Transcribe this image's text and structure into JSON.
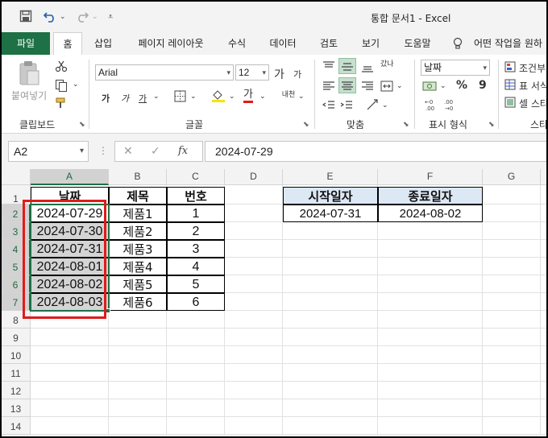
{
  "titlebar": {
    "title": "통합 문서1  -  Excel",
    "save_icon": "save-icon",
    "undo_icon": "undo-icon",
    "redo_icon": "redo-icon"
  },
  "tabs": [
    "파일",
    "홈",
    "삽입",
    "페이지 레이아웃",
    "수식",
    "데이터",
    "검토",
    "보기",
    "도움말"
  ],
  "tell_me": "어떤 작업을 원하",
  "ribbon": {
    "clipboard": {
      "paste": "붙여넣기",
      "label": "클립보드"
    },
    "font": {
      "name": "Arial",
      "size": "12",
      "grow": "가",
      "shrink": "가",
      "bold": "가",
      "italic": "가",
      "underline": "가",
      "color_a": "가",
      "phonetic": "내천",
      "label": "글꼴"
    },
    "align": {
      "wrap": "갔나",
      "label": "맞춤"
    },
    "number": {
      "format": "날짜",
      "percent": "%",
      "comma": "9",
      "label": "표시 형식"
    },
    "styles": {
      "cond": "조건부",
      "table": "표 서식",
      "cell": "셀 스타",
      "label": "스타"
    }
  },
  "formula_bar": {
    "name_box": "A2",
    "fx": "fx",
    "value": "2024-07-29"
  },
  "columns": [
    "A",
    "B",
    "C",
    "D",
    "E",
    "F",
    "G"
  ],
  "rows": [
    "1",
    "2",
    "3",
    "4",
    "5",
    "6",
    "7",
    "8",
    "9",
    "10",
    "11",
    "12",
    "13",
    "14"
  ],
  "table": {
    "headers": [
      "날짜",
      "제목",
      "번호"
    ],
    "dates": [
      "2024-07-29",
      "2024-07-30",
      "2024-07-31",
      "2024-08-01",
      "2024-08-02",
      "2024-08-03"
    ],
    "titles": [
      "제품1",
      "제품2",
      "제품3",
      "제품4",
      "제품5",
      "제품6"
    ],
    "numbers": [
      "1",
      "2",
      "3",
      "4",
      "5",
      "6"
    ]
  },
  "range_table": {
    "headers": [
      "시작일자",
      "종료일자"
    ],
    "values": [
      "2024-07-31",
      "2024-08-02"
    ]
  },
  "colors": {
    "excel_green": "#1e7145",
    "highlight_red": "#e01b1b",
    "header_blue": "#dde8f5"
  }
}
